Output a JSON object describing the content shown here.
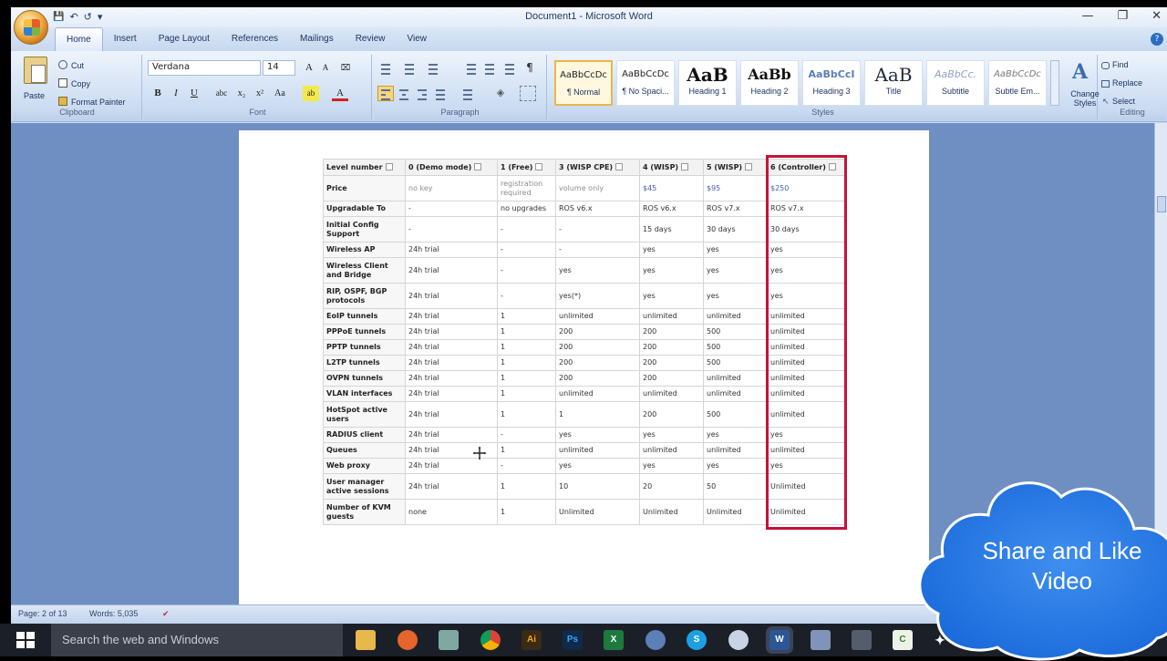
{
  "window": {
    "title": "Document1 - Microsoft Word",
    "minimize": "—",
    "restore": "❐",
    "close": "✕"
  },
  "qat": {
    "save": "💾",
    "undo": "↶",
    "redo": "↺",
    "more": "▾"
  },
  "tabs": [
    "Home",
    "Insert",
    "Page Layout",
    "References",
    "Mailings",
    "Review",
    "View"
  ],
  "help": "?",
  "ribbon": {
    "clipboard": {
      "label": "Clipboard",
      "paste": "Paste",
      "cut": "Cut",
      "copy": "Copy",
      "format_painter": "Format Painter"
    },
    "font": {
      "label": "Font",
      "family": "Verdana",
      "size": "14"
    },
    "paragraph": {
      "label": "Paragraph"
    },
    "styles": {
      "label": "Styles",
      "items": [
        {
          "sample": "AaBbCcDc",
          "name": "¶ Normal"
        },
        {
          "sample": "AaBbCcDc",
          "name": "¶ No Spaci..."
        },
        {
          "sample": "AaB",
          "name": "Heading 1"
        },
        {
          "sample": "AaBb",
          "name": "Heading 2"
        },
        {
          "sample": "AaBbCcI",
          "name": "Heading 3"
        },
        {
          "sample": "AaB",
          "name": "Title"
        },
        {
          "sample": "AaBbCc.",
          "name": "Subtitle"
        },
        {
          "sample": "AaBbCcDc",
          "name": "Subtle Em..."
        }
      ],
      "change_styles": "Change Styles"
    },
    "editing": {
      "label": "Editing",
      "find": "Find",
      "replace": "Replace",
      "select": "Select"
    }
  },
  "table": {
    "headers": [
      "Level number",
      "0 (Demo mode)",
      "1 (Free)",
      "3 (WISP CPE)",
      "4 (WISP)",
      "5 (WISP)",
      "6 (Controller)"
    ],
    "rows": [
      [
        "Price",
        "no key",
        "registration required",
        "volume only",
        "$45",
        "$95",
        "$250"
      ],
      [
        "Upgradable To",
        "-",
        "no upgrades",
        "ROS v6.x",
        "ROS v6.x",
        "ROS v7.x",
        "ROS v7.x"
      ],
      [
        "Initial Config Support",
        "-",
        "-",
        "-",
        "15 days",
        "30 days",
        "30 days"
      ],
      [
        "Wireless AP",
        "24h trial",
        "-",
        "-",
        "yes",
        "yes",
        "yes"
      ],
      [
        "Wireless Client and Bridge",
        "24h trial",
        "-",
        "yes",
        "yes",
        "yes",
        "yes"
      ],
      [
        "RIP, OSPF, BGP protocols",
        "24h trial",
        "-",
        "yes(*)",
        "yes",
        "yes",
        "yes"
      ],
      [
        "EoIP tunnels",
        "24h trial",
        "1",
        "unlimited",
        "unlimited",
        "unlimited",
        "unlimited"
      ],
      [
        "PPPoE tunnels",
        "24h trial",
        "1",
        "200",
        "200",
        "500",
        "unlimited"
      ],
      [
        "PPTP tunnels",
        "24h trial",
        "1",
        "200",
        "200",
        "500",
        "unlimited"
      ],
      [
        "L2TP tunnels",
        "24h trial",
        "1",
        "200",
        "200",
        "500",
        "unlimited"
      ],
      [
        "OVPN tunnels",
        "24h trial",
        "1",
        "200",
        "200",
        "unlimited",
        "unlimited"
      ],
      [
        "VLAN interfaces",
        "24h trial",
        "1",
        "unlimited",
        "unlimited",
        "unlimited",
        "unlimited"
      ],
      [
        "HotSpot active users",
        "24h trial",
        "1",
        "1",
        "200",
        "500",
        "unlimited"
      ],
      [
        "RADIUS client",
        "24h trial",
        "-",
        "yes",
        "yes",
        "yes",
        "yes"
      ],
      [
        "Queues",
        "24h trial",
        "1",
        "unlimited",
        "unlimited",
        "unlimited",
        "unlimited"
      ],
      [
        "Web proxy",
        "24h trial",
        "-",
        "yes",
        "yes",
        "yes",
        "yes"
      ],
      [
        "User manager active sessions",
        "24h trial",
        "1",
        "10",
        "20",
        "50",
        "Unlimited"
      ],
      [
        "Number of KVM guests",
        "none",
        "1",
        "Unlimited",
        "Unlimited",
        "Unlimited",
        "Unlimited"
      ]
    ]
  },
  "status": {
    "page": "Page: 2 of 13",
    "words": "Words: 5,035"
  },
  "taskbar": {
    "search_placeholder": "Search the web and Windows"
  },
  "overlay": {
    "line1": "Share and Like",
    "line2": "Video"
  }
}
